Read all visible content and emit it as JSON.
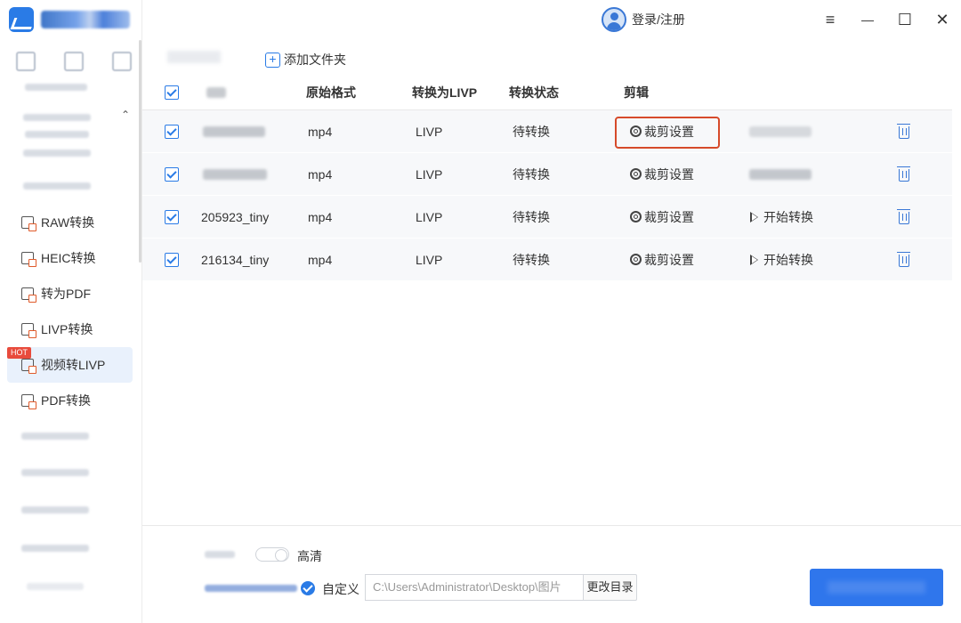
{
  "topbar": {
    "login_label": "登录/注册",
    "menu_icon": "≡",
    "minimize_icon": "—",
    "maximize_icon": "☐",
    "close_icon": "✕"
  },
  "sidebar": {
    "items": [
      {
        "label": "RAW转换",
        "icon": "raw-convert-icon"
      },
      {
        "label": "HEIC转换",
        "icon": "heic-convert-icon"
      },
      {
        "label": "转为PDF",
        "icon": "to-pdf-icon"
      },
      {
        "label": "LIVP转换",
        "icon": "livp-convert-icon"
      },
      {
        "label": "视频转LIVP",
        "icon": "video-to-livp-icon",
        "active": true
      },
      {
        "label": "PDF转换",
        "icon": "pdf-convert-icon"
      }
    ],
    "hot_badge": "HOT",
    "collapse_arrow": "⌃"
  },
  "toolbar": {
    "add_folder_label": "添加文件夹",
    "add_folder_plus": "+"
  },
  "table": {
    "headers": {
      "source_format": "原始格式",
      "convert_to": "转换为LIVP",
      "status": "转换状态",
      "edit": "剪辑"
    },
    "rows": [
      {
        "name": "",
        "format": "mp4",
        "target": "LIVP",
        "status": "待转换",
        "edit": "裁剪设置",
        "action": ""
      },
      {
        "name": "",
        "format": "mp4",
        "target": "LIVP",
        "status": "待转换",
        "edit": "裁剪设置",
        "action": ""
      },
      {
        "name": "205923_tiny",
        "format": "mp4",
        "target": "LIVP",
        "status": "待转换",
        "edit": "裁剪设置",
        "action": "开始转换"
      },
      {
        "name": "216134_tiny",
        "format": "mp4",
        "target": "LIVP",
        "status": "待转换",
        "edit": "裁剪设置",
        "action": "开始转换"
      }
    ]
  },
  "footer": {
    "quality_label": "高清",
    "custom_label": "自定义",
    "path_value": "C:\\Users\\Administrator\\Desktop\\图片",
    "change_dir_label": "更改目录"
  },
  "colors": {
    "accent": "#2a7be6",
    "highlight_border": "#d64a2a",
    "hot_badge": "#e84b3c",
    "row_bg": "#f7f8fa"
  }
}
